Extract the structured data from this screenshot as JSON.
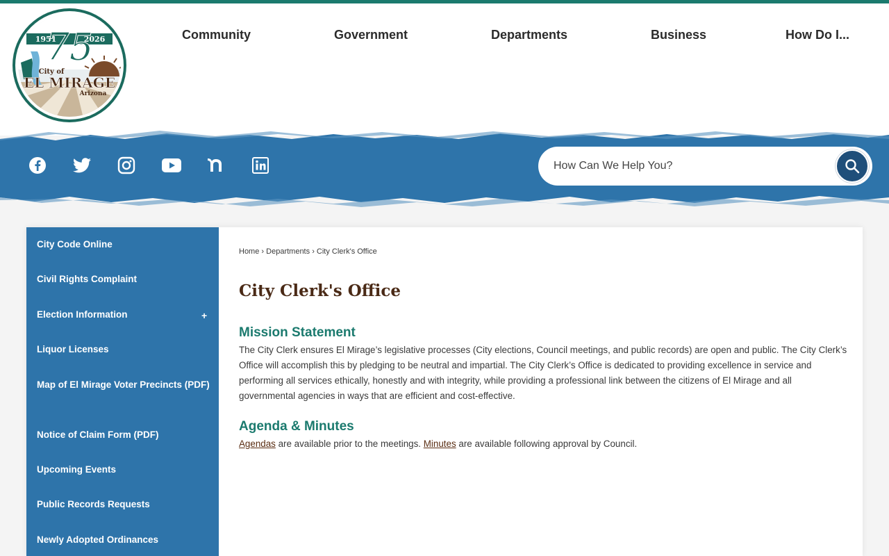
{
  "header": {
    "logo": {
      "years_left": "1951",
      "years_right": "2026",
      "anniversary": "75",
      "city_prefix": "City of",
      "city_name": "EL MIRAGE",
      "state": "Arizona"
    },
    "nav": [
      "Community",
      "Government",
      "Departments",
      "Business",
      "How Do I..."
    ]
  },
  "social": [
    {
      "name": "facebook-icon"
    },
    {
      "name": "twitter-icon"
    },
    {
      "name": "instagram-icon"
    },
    {
      "name": "youtube-icon"
    },
    {
      "name": "nextdoor-icon"
    },
    {
      "name": "linkedin-icon"
    }
  ],
  "search": {
    "placeholder": "How Can We Help You?"
  },
  "sidebar": {
    "items": [
      {
        "label": "City Code Online"
      },
      {
        "label": "Civil Rights Complaint"
      },
      {
        "label": "Election Information",
        "expand": "+"
      },
      {
        "label": "Liquor Licenses"
      },
      {
        "label": "Map of El Mirage Voter Precincts (PDF)"
      },
      {
        "label": "Notice of Claim Form (PDF)"
      },
      {
        "label": "Upcoming Events"
      },
      {
        "label": "Public Records Requests"
      },
      {
        "label": "Newly Adopted Ordinances"
      }
    ]
  },
  "breadcrumb": {
    "home": "Home",
    "sep": "›",
    "departments": "Departments",
    "current": "City Clerk's Office"
  },
  "main": {
    "title": "City Clerk's Office",
    "mission_heading": "Mission Statement",
    "mission_text": "The City Clerk ensures El Mirage’s legislative processes (City elections, Council meetings, and public records) are open and public. The City Clerk’s Office will accomplish this by pledging to be neutral and impartial. The City Clerk’s Office is dedicated to providing excellence in service and performing all services ethically, honestly and with integrity, while providing a professional link between the citizens of El Mirage and all governmental agencies in ways that are efficient and cost-effective.",
    "agenda_heading": "Agenda & Minutes",
    "agendas_link": "Agendas",
    "agenda_text_1": " are available prior to the meetings. ",
    "minutes_link": "Minutes",
    "agenda_text_2": " are available following approval by Council."
  },
  "colors": {
    "teal": "#1b7a6e",
    "blue": "#2e74aa",
    "brown": "#4a2a16"
  }
}
